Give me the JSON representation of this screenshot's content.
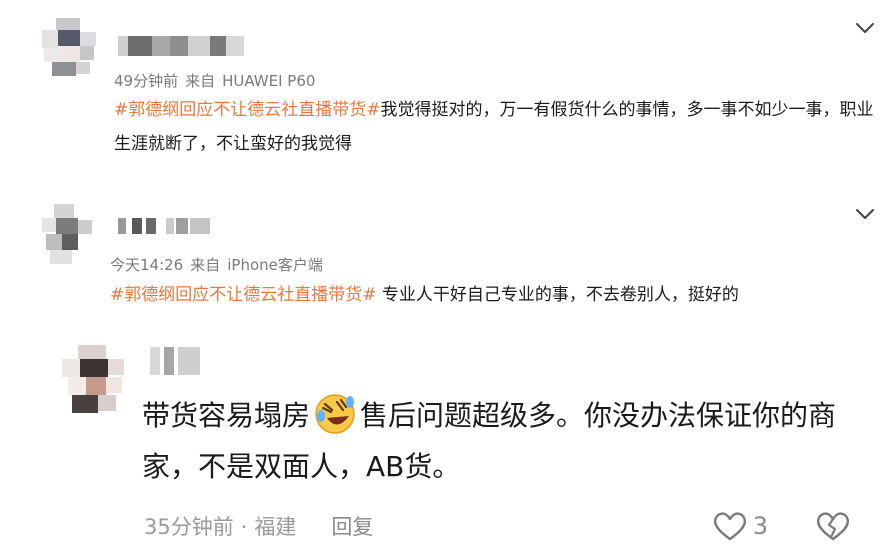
{
  "comments": [
    {
      "meta": {
        "time": "49分钟前",
        "source_prefix": "来自",
        "source": "HUAWEI P60"
      },
      "body": {
        "topic": "#郭德纲回应不让德云社直播带货#",
        "text": "我觉得挺对的，万一有假货什么的事情，多一事不如少一事，职业生涯就断了，不让蛮好的我觉得"
      },
      "expand_icon": "chevron-down-icon"
    },
    {
      "meta": {
        "time": "今天14:26",
        "source_prefix": "来自",
        "source": "iPhone客户端"
      },
      "body": {
        "topic": "#郭德纲回应不让德云社直播带货#",
        "text": " 专业人干好自己专业的事，不去卷别人，挺好的"
      },
      "expand_icon": "chevron-down-icon"
    }
  ],
  "reply": {
    "body": {
      "text_before_emoji": "带货容易塌房",
      "emoji": "rolling-on-floor-laughing-emoji",
      "text_after_emoji": "售后问题超级多。你没办法保证你的商家，不是双面人，AB货。"
    },
    "meta": {
      "time": "35分钟前",
      "separator": "·",
      "location": "福建",
      "reply_label": "回复"
    },
    "like_count": "3",
    "like_icon": "heart-outline-icon",
    "dislike_icon": "broken-heart-icon"
  },
  "colors": {
    "topic": "#e9783e",
    "meta": "#7a7a7a",
    "body": "#1b1b1b"
  }
}
